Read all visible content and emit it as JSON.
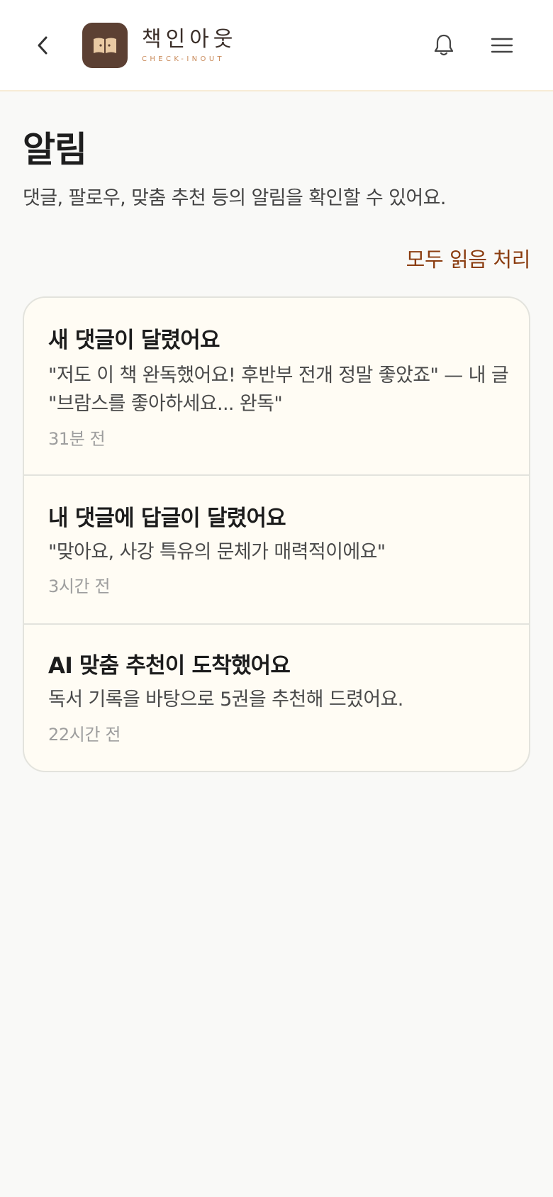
{
  "header": {
    "brand_ko": "책인아웃",
    "brand_en": "CHECK-INOUT",
    "icons": {
      "back": "chevron-left-icon",
      "logo": "open-book-icon",
      "notifications": "bell-icon",
      "menu": "hamburger-menu-icon"
    }
  },
  "page": {
    "title": "알림",
    "subtitle": "댓글, 팔로우, 맞춤 추천 등의 알림을 확인할 수 있어요.",
    "mark_all_read": "모두 읽음 처리"
  },
  "notifications": [
    {
      "title": "새 댓글이 달렸어요",
      "body": "\"저도 이 책 완독했어요! 후반부 전개 정말 좋았죠\" — 내 글 \"브람스를 좋아하세요... 완독\"",
      "time": "31분 전"
    },
    {
      "title": "내 댓글에 답글이 달렸어요",
      "body": "\"맞아요, 사강 특유의 문체가 매력적이에요\"",
      "time": "3시간 전"
    },
    {
      "title": "AI 맞춤 추천이 도착했어요",
      "body": "독서 기록을 바탕으로 5권을 추천해 드렸어요.",
      "time": "22시간 전"
    }
  ],
  "colors": {
    "accent": "#8b3d10",
    "logo_bg": "#5c4033",
    "card_bg": "#fffcf4",
    "page_bg": "#f9f9f7"
  }
}
